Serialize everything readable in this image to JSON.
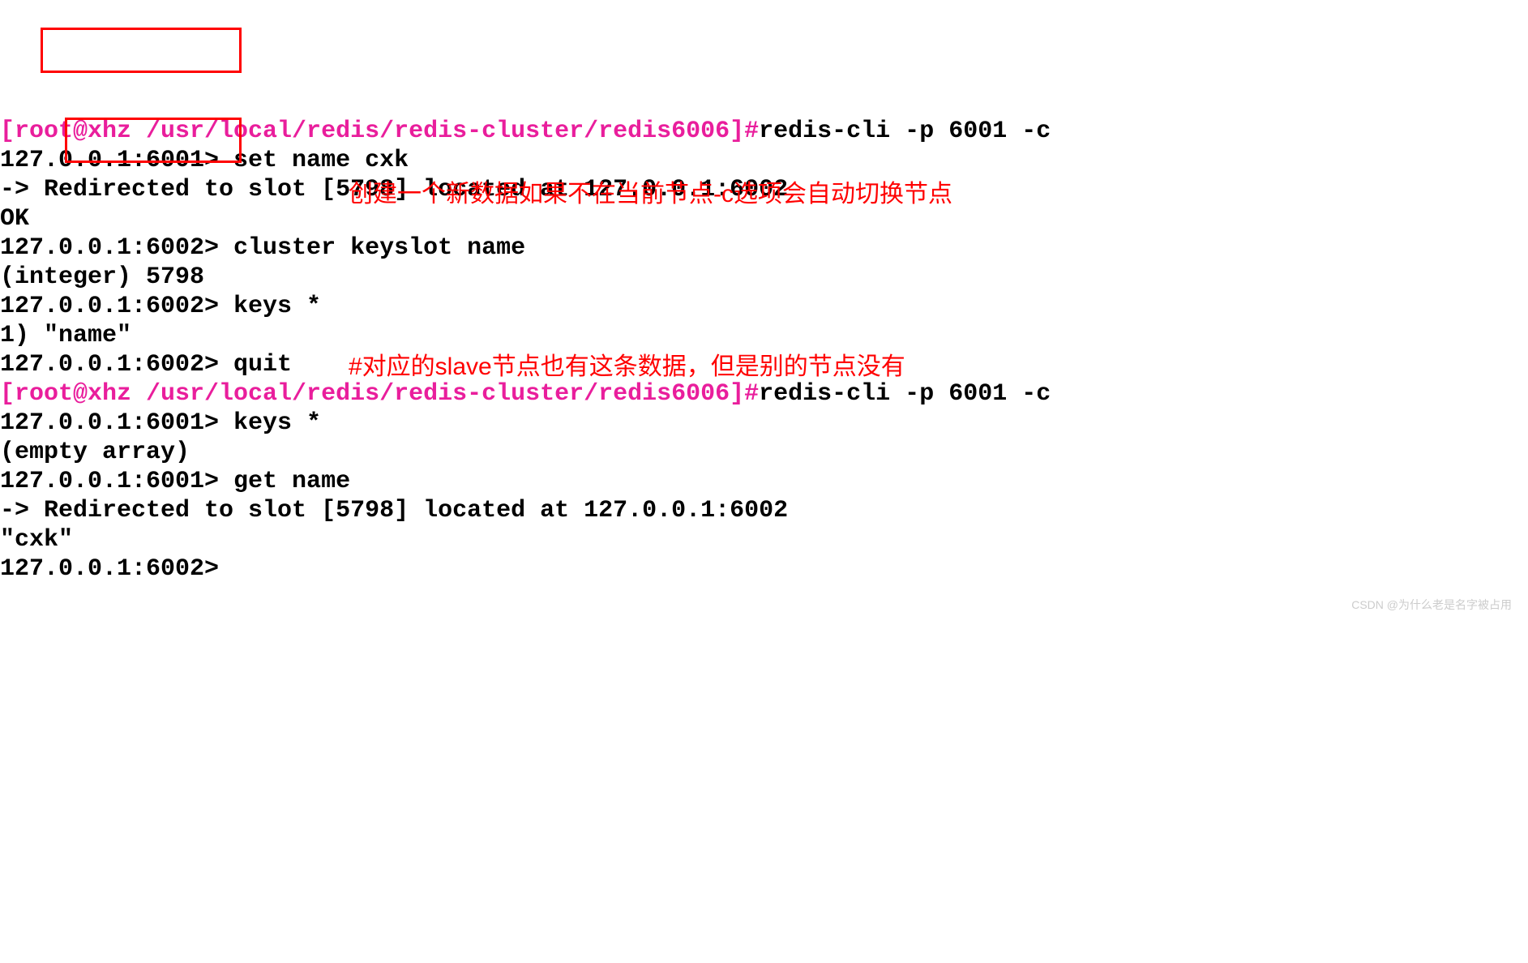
{
  "terminal": {
    "lines": [
      {
        "segments": [
          {
            "cls": "magenta",
            "text": "[root@xhz /usr/local/redis/redis-cluster/redis6006]#"
          },
          {
            "cls": "black",
            "text": "redis-cli -p 6001 -c"
          }
        ]
      },
      {
        "segments": [
          {
            "cls": "black",
            "text": "127.0.0.1:6001> set name cxk"
          }
        ]
      },
      {
        "segments": [
          {
            "cls": "black",
            "text": "-> Redirected to slot [5798] located at 127.0.0.1:6002"
          }
        ]
      },
      {
        "segments": [
          {
            "cls": "black",
            "text": "OK"
          }
        ]
      },
      {
        "segments": [
          {
            "cls": "black",
            "text": "127.0.0.1:6002> cluster keyslot name"
          }
        ]
      },
      {
        "segments": [
          {
            "cls": "black",
            "text": "(integer) 5798"
          }
        ]
      },
      {
        "segments": [
          {
            "cls": "black",
            "text": "127.0.0.1:6002> keys *"
          }
        ]
      },
      {
        "segments": [
          {
            "cls": "black",
            "text": "1) \"name\""
          }
        ]
      },
      {
        "segments": [
          {
            "cls": "black",
            "text": "127.0.0.1:6002> quit"
          }
        ]
      },
      {
        "segments": [
          {
            "cls": "magenta",
            "text": "[root@xhz /usr/local/redis/redis-cluster/redis6006]#"
          },
          {
            "cls": "black",
            "text": "redis-cli -p 6001 -c"
          }
        ]
      },
      {
        "segments": [
          {
            "cls": "black",
            "text": "127.0.0.1:6001> keys *"
          }
        ]
      },
      {
        "segments": [
          {
            "cls": "black",
            "text": "(empty array)"
          }
        ]
      },
      {
        "segments": [
          {
            "cls": "black",
            "text": "127.0.0.1:6001> get name"
          }
        ]
      },
      {
        "segments": [
          {
            "cls": "black",
            "text": "-> Redirected to slot [5798] located at 127.0.0.1:6002"
          }
        ]
      },
      {
        "segments": [
          {
            "cls": "black",
            "text": "\"cxk\""
          }
        ]
      },
      {
        "segments": [
          {
            "cls": "black",
            "text": "127.0.0.1:6002>"
          }
        ]
      }
    ]
  },
  "annotations": {
    "a1": "创建一个新数据如果不在当前节点-c选项会自动切换节点",
    "a2": "#对应的slave节点也有这条数据，但是别的节点没有"
  },
  "watermark": "CSDN @为什么老是名字被占用"
}
